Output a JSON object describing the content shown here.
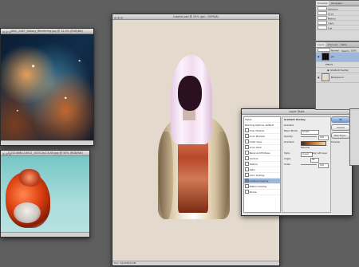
{
  "windows": {
    "nebula": {
      "title": "NGC_2467_Galaxy_Rendering.jpg @ 12.5% (RGB/8#)",
      "status": ""
    },
    "mineral": {
      "title": "112114080.10012_1003-3x2-6-Sh.jpg @ 50% (RGB/8#)",
      "status": ""
    },
    "main": {
      "title": "tutorial.psd @ 25% (girl, CMYK/8)",
      "status": "Doc: 56.2M/56.9M"
    },
    "layer_style": {
      "title": "Layer Style",
      "styles_header": "Styles",
      "styles": [
        {
          "label": "Blending Options: Default",
          "checked": false,
          "selected": false
        },
        {
          "label": "Drop Shadow",
          "checked": false,
          "selected": false
        },
        {
          "label": "Inner Shadow",
          "checked": false,
          "selected": false
        },
        {
          "label": "Outer Glow",
          "checked": false,
          "selected": false
        },
        {
          "label": "Inner Glow",
          "checked": false,
          "selected": false
        },
        {
          "label": "Bevel and Emboss",
          "checked": false,
          "selected": false
        },
        {
          "label": "Contour",
          "checked": false,
          "selected": false
        },
        {
          "label": "Texture",
          "checked": false,
          "selected": false
        },
        {
          "label": "Satin",
          "checked": false,
          "selected": false
        },
        {
          "label": "Color Overlay",
          "checked": false,
          "selected": false
        },
        {
          "label": "Gradient Overlay",
          "checked": true,
          "selected": true
        },
        {
          "label": "Pattern Overlay",
          "checked": false,
          "selected": false
        },
        {
          "label": "Stroke",
          "checked": false,
          "selected": false
        }
      ],
      "section_title": "Gradient Overlay",
      "section_sub": "Gradient",
      "fields": {
        "blend_label": "Blend Mode:",
        "blend_value": "Screen",
        "opacity_label": "Opacity:",
        "opacity_value": "100",
        "gradient_label": "Gradient:",
        "reverse_label": "Reverse",
        "style_label": "Style:",
        "style_value": "Linear",
        "align_label": "Align with Layer",
        "angle_label": "Angle:",
        "angle_value": "90",
        "scale_label": "Scale:",
        "scale_value": "100"
      },
      "buttons": {
        "ok": "OK",
        "cancel": "Cancel",
        "new_style": "New Style...",
        "preview": "Preview"
      }
    }
  },
  "panels": {
    "character": {
      "tabs": [
        "Character",
        "Paragraph"
      ],
      "font_value": "Helvetica",
      "size_value": "12 pt",
      "rows": [
        "Metrics",
        "100%",
        "0 pt"
      ]
    },
    "layers": {
      "tabs": [
        "Layers",
        "Channels",
        "Paths"
      ],
      "mode_value": "Normal",
      "opacity_label": "Opacity:",
      "opacity_value": "100%",
      "items": [
        {
          "name": "girl",
          "selected": true
        },
        {
          "name": "Effects",
          "selected": false
        },
        {
          "name": "Gradient Overlay",
          "selected": false
        },
        {
          "name": "Background",
          "selected": false
        }
      ]
    }
  }
}
